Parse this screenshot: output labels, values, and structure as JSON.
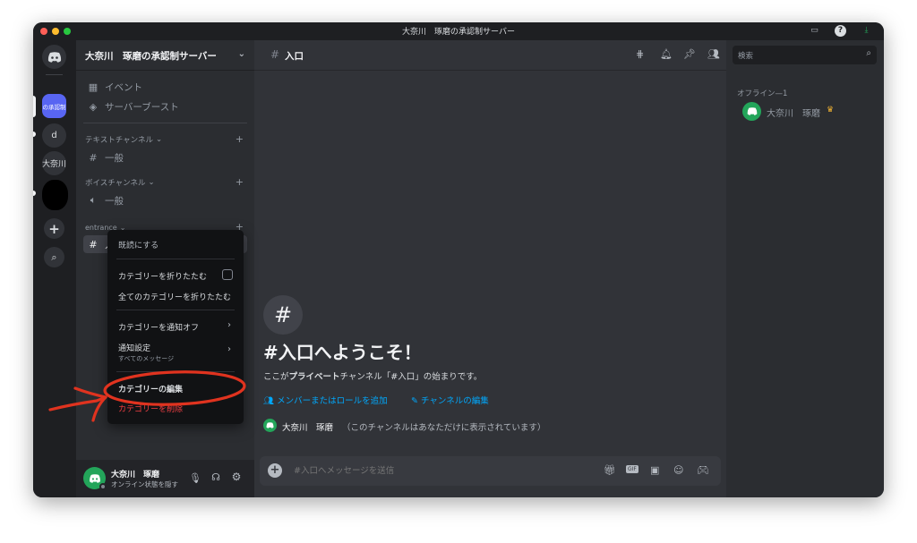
{
  "window": {
    "title": "大奈川　琢磨の承認制サーバー"
  },
  "server_list": {
    "items": [
      {
        "name": "discord-home",
        "label": ""
      },
      {
        "name": "server-active",
        "label": "の承認制"
      },
      {
        "name": "server-d",
        "label": "d"
      },
      {
        "name": "server-daina",
        "label": "大奈川"
      },
      {
        "name": "server-hidden",
        "label": ""
      },
      {
        "name": "add-server",
        "label": "+"
      },
      {
        "name": "explore",
        "label": "⌕"
      }
    ]
  },
  "server": {
    "name": "大奈川　琢磨の承認制サーバー",
    "events_label": "イベント",
    "boost_label": "サーバーブースト"
  },
  "categories": [
    {
      "label": "テキストチャンネル",
      "channel": "一般"
    },
    {
      "label": "ボイスチャンネル",
      "channel": "一般"
    },
    {
      "label": "entrance",
      "channel": "入口"
    }
  ],
  "context_menu": {
    "mark_read": "既読にする",
    "collapse_category": "カテゴリーを折りたたむ",
    "collapse_all": "全てのカテゴリーを折りたたむ",
    "mute_category": "カテゴリーを通知オフ",
    "notification_settings": "通知設定",
    "notification_sub": "すべてのメッセージ",
    "edit_category": "カテゴリーの編集",
    "delete_category": "カテゴリーを削除"
  },
  "user": {
    "name": "大奈川　琢磨",
    "status": "オンライン状態を隠す"
  },
  "channel_header": {
    "name": "入口"
  },
  "welcome": {
    "title": "#入口へようこそ！",
    "desc_prefix": "ここが",
    "desc_bold": "プライベート",
    "desc_suffix": "チャンネル「#入口」の始まりです。",
    "add_members": "メンバーまたはロールを追加",
    "edit_channel": "チャンネルの編集",
    "user_name": "大奈川　琢磨",
    "visibility_note": "（このチャンネルはあなただけに表示されています）"
  },
  "composer": {
    "placeholder": "#入口へメッセージを送信"
  },
  "search": {
    "placeholder": "検索"
  },
  "members": {
    "section_label": "オフライン—1",
    "items": [
      {
        "name": "大奈川　琢磨"
      }
    ]
  },
  "colors": {
    "accent": "#5865f2",
    "link": "#00a8fc",
    "annotation": "#e0331f",
    "online": "#23a55a",
    "crown": "#f0b232"
  }
}
